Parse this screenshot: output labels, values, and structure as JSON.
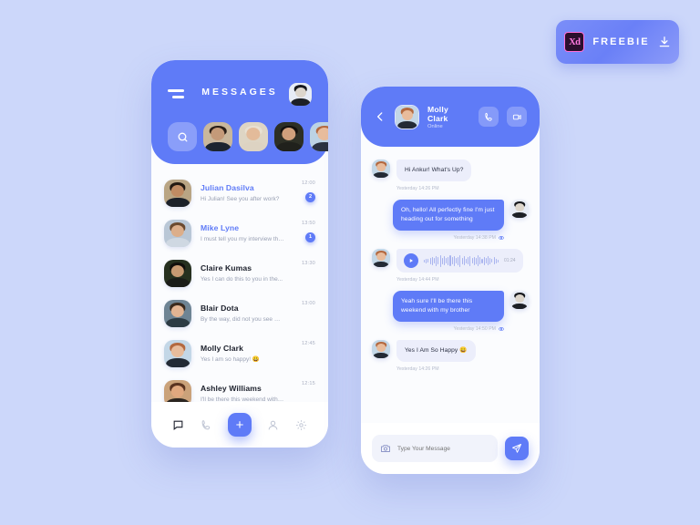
{
  "badge": {
    "logo": "Xd",
    "label": "FREEBIE",
    "download_icon": "download-icon"
  },
  "messages_screen": {
    "title": "MESSAGES",
    "menu_icon": "hamburger-icon",
    "profile_icon": "profile-avatar",
    "search_icon": "search-icon",
    "stories": [
      {
        "name": "story-1",
        "skin": "#c49a79",
        "hair": "#2a1f18",
        "shirt": "#1c2530",
        "bg": "#c9b79c"
      },
      {
        "name": "story-2",
        "skin": "#e3bb9a",
        "hair": "#e8e0d2",
        "shirt": "#ddd3c2",
        "bg": "#ded5c4"
      },
      {
        "name": "story-3",
        "skin": "#d0a07c",
        "hair": "#14110e",
        "shirt": "#20211c",
        "bg": "#2d2f25"
      },
      {
        "name": "story-4",
        "skin": "#e8bc9c",
        "hair": "#b4693f",
        "shirt": "#2b3340",
        "bg": "#bcd3e4"
      },
      {
        "name": "story-5",
        "skin": "#d6a580",
        "hair": "#4b3524",
        "shirt": "#35302c",
        "bg": "#8a7e6e"
      },
      {
        "name": "story-6",
        "skin": "#c99a74",
        "hair": "#241a12",
        "shirt": "#2a2723",
        "bg": "#6f6154"
      }
    ],
    "conversations": [
      {
        "name": "Julian Dasilva",
        "preview": "Hi Julian! See you after work?",
        "time": "12:00",
        "badge": "2",
        "unread": true,
        "avatar": {
          "skin": "#c08b63",
          "hair": "#241a12",
          "shirt": "#1b2029",
          "bg": "#b9a584"
        }
      },
      {
        "name": "Mike Lyne",
        "preview": "I must tell you my interview this...",
        "time": "13:50",
        "badge": "1",
        "unread": true,
        "avatar": {
          "skin": "#dcae8a",
          "hair": "#6b4a2f",
          "shirt": "#cfd8e2",
          "bg": "#b9c7d6"
        }
      },
      {
        "name": "Claire Kumas",
        "preview": "Yes I can do this to you in the...",
        "time": "13:30",
        "badge": "",
        "unread": false,
        "avatar": {
          "skin": "#c89a72",
          "hair": "#120f0c",
          "shirt": "#1a1c18",
          "bg": "#26301f"
        }
      },
      {
        "name": "Blair Dota",
        "preview": "By the way, did not you see my...",
        "time": "13:00",
        "badge": "",
        "unread": false,
        "avatar": {
          "skin": "#e2b493",
          "hair": "#3a2a1e",
          "shirt": "#2c3b44",
          "bg": "#6e8494"
        }
      },
      {
        "name": "Molly Clark",
        "preview": "Yes I am so happy! 😀",
        "time": "12:45",
        "badge": "",
        "unread": false,
        "avatar": {
          "skin": "#e8bc9c",
          "hair": "#b4693f",
          "shirt": "#232a35",
          "bg": "#c3d7e7"
        }
      },
      {
        "name": "Ashley Williams",
        "preview": "I'll be there this weekend with my...",
        "time": "12:15",
        "badge": "",
        "unread": false,
        "avatar": {
          "skin": "#e0a87f",
          "hair": "#5a3320",
          "shirt": "#2b2520",
          "bg": "#caa27a"
        }
      }
    ],
    "nav": [
      {
        "name": "nav-chat",
        "icon": "chat-icon",
        "active": true
      },
      {
        "name": "nav-calls",
        "icon": "phone-icon",
        "active": false
      },
      {
        "name": "nav-add",
        "icon": "plus-icon",
        "active": false
      },
      {
        "name": "nav-contacts",
        "icon": "person-icon",
        "active": false
      },
      {
        "name": "nav-settings",
        "icon": "gear-icon",
        "active": false
      }
    ],
    "plus_label": "+"
  },
  "chat_screen": {
    "back_icon": "back-arrow-icon",
    "contact_name": "Molly Clark",
    "status": "Online",
    "call_icon": "phone-icon",
    "video_icon": "video-camera-icon",
    "messages": [
      {
        "dir": "in",
        "type": "text",
        "text": "Hi Ankur! What's Up?",
        "stamp": "Yesterday 14:26 PM",
        "seen": false
      },
      {
        "dir": "out",
        "type": "text",
        "text": "Oh, hello! All perfectly fine I'm just heading out for something",
        "stamp": "Yesterday 14:38 PM",
        "seen": true
      },
      {
        "dir": "in",
        "type": "voice",
        "duration": "01:24",
        "stamp": "Yesterday 14:44 PM",
        "seen": false
      },
      {
        "dir": "out",
        "type": "text",
        "text": "Yeah sure I'll be there this weekend with my brother",
        "stamp": "Yesterday 14:50 PM",
        "seen": true
      },
      {
        "dir": "in",
        "type": "text",
        "text": "Yes I Am So Happy  😀",
        "stamp": "Yesterday 14:26 PM",
        "seen": false
      }
    ],
    "input": {
      "placeholder": "Type Your Message",
      "value": "",
      "camera_icon": "camera-icon",
      "send_icon": "send-plane-icon"
    }
  },
  "colors": {
    "accent": "#5f7bf7",
    "page_bg": "#ccd7fa",
    "bubble_in": "#eceefb",
    "card": "#fbfcfe"
  }
}
